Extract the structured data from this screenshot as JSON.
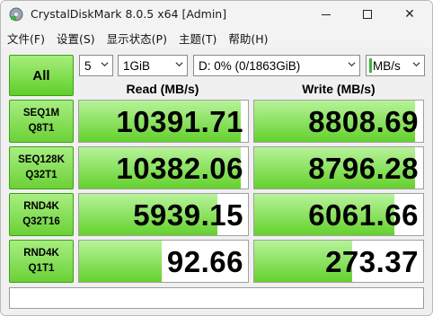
{
  "window": {
    "title": "CrystalDiskMark 8.0.5 x64 [Admin]",
    "controls": {
      "minimize": "minimize",
      "maximize": "maximize",
      "close": "✕"
    }
  },
  "menu": [
    "文件(F)",
    "设置(S)",
    "显示状态(P)",
    "主题(T)",
    "帮助(H)"
  ],
  "toolbar": {
    "all_label": "All",
    "count": "5",
    "size": "1GiB",
    "drive": "D: 0% (0/1863GiB)",
    "unit": "MB/s"
  },
  "headers": {
    "read": "Read (MB/s)",
    "write": "Write (MB/s)"
  },
  "rows": [
    {
      "line1": "SEQ1M",
      "line2": "Q8T1",
      "read": "10391.71",
      "write": "8808.69",
      "read_fill": 0.96,
      "write_fill": 0.95
    },
    {
      "line1": "SEQ128K",
      "line2": "Q32T1",
      "read": "10382.06",
      "write": "8796.28",
      "read_fill": 0.96,
      "write_fill": 0.95
    },
    {
      "line1": "RND4K",
      "line2": "Q32T16",
      "read": "5939.15",
      "write": "6061.66",
      "read_fill": 0.82,
      "write_fill": 0.83
    },
    {
      "line1": "RND4K",
      "line2": "Q1T1",
      "read": "92.66",
      "write": "273.37",
      "read_fill": 0.49,
      "write_fill": 0.58
    }
  ],
  "comment": "",
  "colors": {
    "accent_green": "#64d12d",
    "unit_accent": "#3cb33c"
  }
}
